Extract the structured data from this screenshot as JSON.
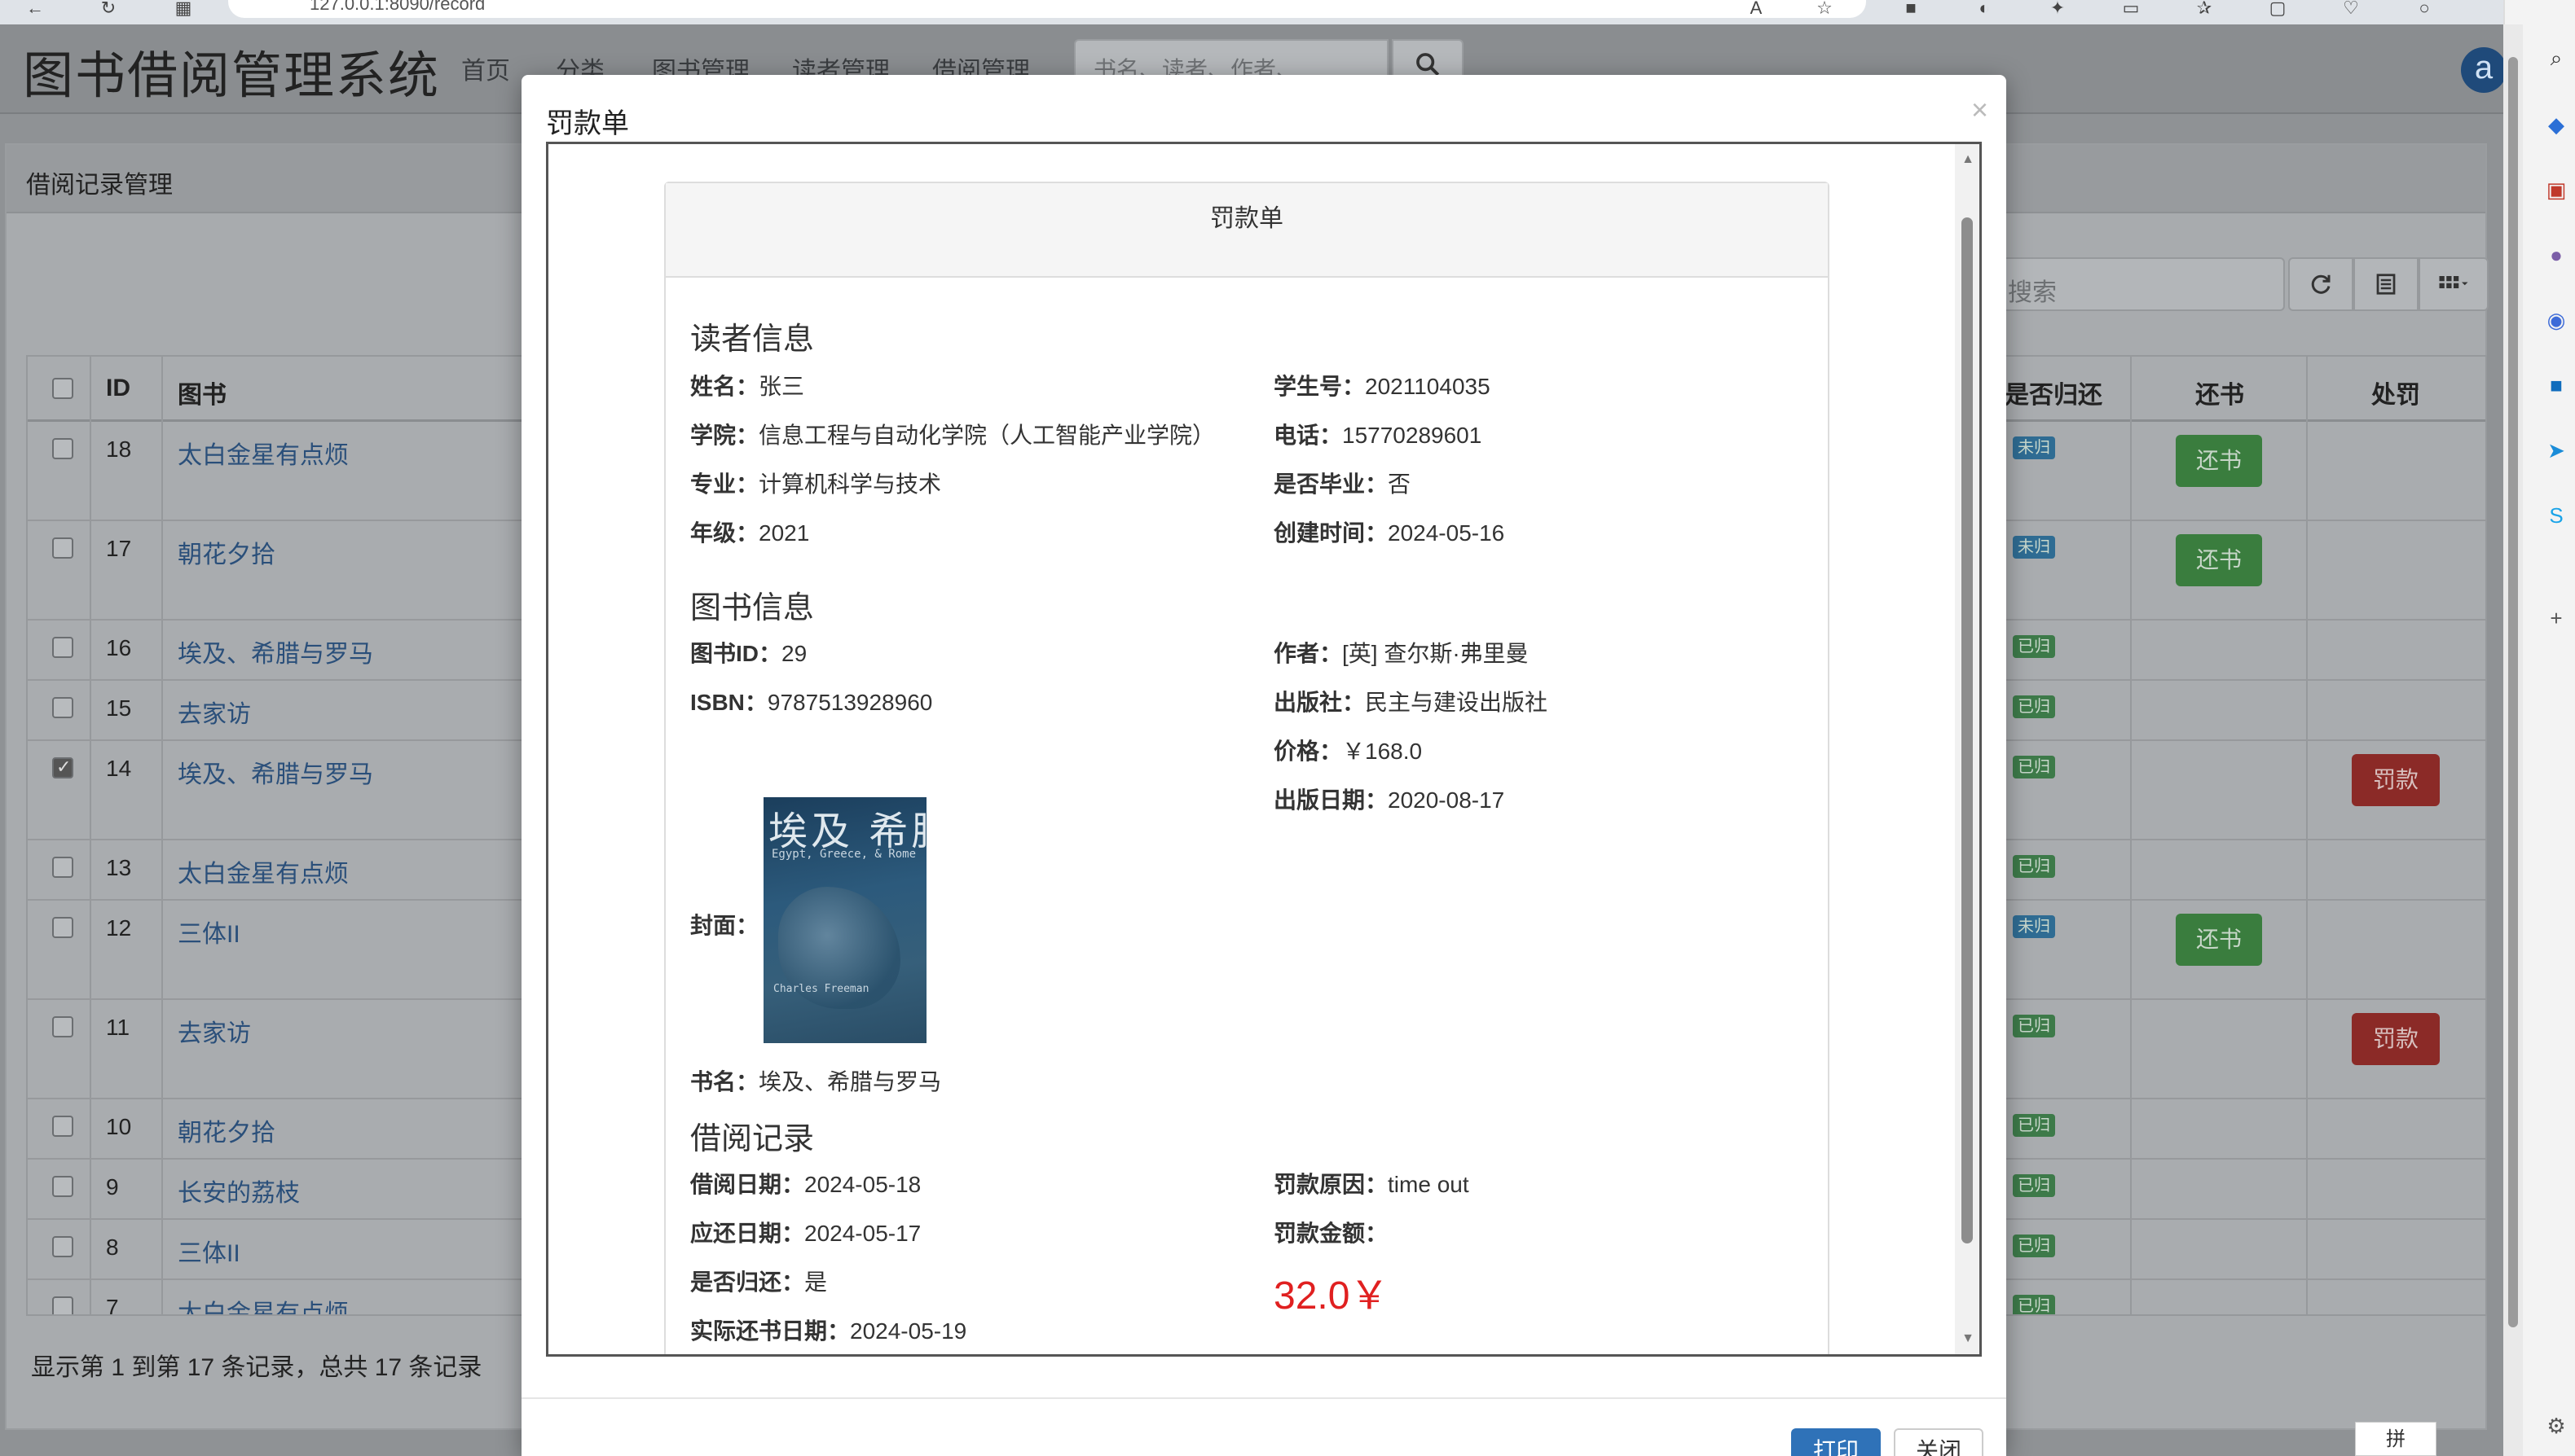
{
  "browser": {
    "url": "127.0.0.1:8090/record"
  },
  "navbar": {
    "brand": "图书借阅管理系统",
    "items": [
      "首页",
      "分类",
      "图书管理",
      "读者管理",
      "借阅管理"
    ],
    "search_placeholder": "书名、读者、作者、ISBN、",
    "avatar_letter": "a"
  },
  "page": {
    "panel_title": "借阅记录管理",
    "table_search_placeholder": "搜索",
    "columns": [
      "ID",
      "图书",
      "是否归还",
      "还书",
      "处罚"
    ],
    "rows": [
      {
        "id": "18",
        "book": "太白金星有点烦",
        "status": "未归还",
        "status_color": "blue",
        "return_btn": "还书",
        "fine_btn": ""
      },
      {
        "id": "17",
        "book": "朝花夕拾",
        "status": "未归还",
        "status_color": "blue",
        "return_btn": "还书",
        "fine_btn": ""
      },
      {
        "id": "16",
        "book": "埃及、希腊与罗马",
        "status": "已归还",
        "status_color": "green",
        "return_btn": "",
        "fine_btn": ""
      },
      {
        "id": "15",
        "book": "去家访",
        "status": "已归还",
        "status_color": "green",
        "return_btn": "",
        "fine_btn": ""
      },
      {
        "id": "14",
        "book": "埃及、希腊与罗马",
        "status": "已归还",
        "status_color": "green",
        "return_btn": "",
        "fine_btn": "罚款",
        "checked": true
      },
      {
        "id": "13",
        "book": "太白金星有点烦",
        "status": "已归还",
        "status_color": "green",
        "return_btn": "",
        "fine_btn": ""
      },
      {
        "id": "12",
        "book": "三体II",
        "status": "未归还",
        "status_color": "blue",
        "return_btn": "还书",
        "fine_btn": ""
      },
      {
        "id": "11",
        "book": "去家访",
        "status": "已归还",
        "status_color": "green",
        "return_btn": "",
        "fine_btn": "罚款"
      },
      {
        "id": "10",
        "book": "朝花夕拾",
        "status": "已归还",
        "status_color": "green",
        "return_btn": "",
        "fine_btn": ""
      },
      {
        "id": "9",
        "book": "长安的荔枝",
        "status": "已归还",
        "status_color": "green",
        "return_btn": "",
        "fine_btn": ""
      },
      {
        "id": "8",
        "book": "三体II",
        "status": "已归还",
        "status_color": "green",
        "return_btn": "",
        "fine_btn": ""
      },
      {
        "id": "7",
        "book": "太白金星有点烦",
        "status": "已归还",
        "status_color": "green",
        "return_btn": "",
        "fine_btn": ""
      }
    ],
    "pagination_info": "显示第 1 到第 17 条记录，总共 17 条记录"
  },
  "modal": {
    "title": "罚款单",
    "close_glyph": "×",
    "print_label": "打印",
    "close_label": "关闭",
    "sheet": {
      "heading": "罚款单",
      "reader_section": "读者信息",
      "reader": {
        "name_label": "姓名：",
        "name": "张三",
        "student_no_label": "学生号：",
        "student_no": "2021104035",
        "college_label": "学院：",
        "college": "信息工程与自动化学院（人工智能产业学院）",
        "phone_label": "电话：",
        "phone": "15770289601",
        "major_label": "专业：",
        "major": "计算机科学与技术",
        "graduated_label": "是否毕业：",
        "graduated": "否",
        "grade_label": "年级：",
        "grade": "2021",
        "created_label": "创建时间：",
        "created": "2024-05-16"
      },
      "book_section": "图书信息",
      "book": {
        "id_label": "图书ID：",
        "id": "29",
        "author_label": "作者：",
        "author": "[英] 查尔斯·弗里曼",
        "isbn_label": "ISBN：",
        "isbn": "9787513928960",
        "publisher_label": "出版社：",
        "publisher": "民主与建设出版社",
        "price_label": "价格：",
        "price": "￥168.0",
        "pubdate_label": "出版日期：",
        "pubdate": "2020-08-17",
        "cover_label": "封面：",
        "title_label": "书名：",
        "title": "埃及、希腊与罗马",
        "cover_title": "埃及 希腊",
        "cover_subtitle": "Egypt, Greece, & Rome",
        "cover_author": "Charles Freeman"
      },
      "record_section": "借阅记录",
      "record": {
        "borrow_date_label": "借阅日期：",
        "borrow_date": "2024-05-18",
        "fine_reason_label": "罚款原因：",
        "fine_reason": "time out",
        "due_date_label": "应还日期：",
        "due_date": "2024-05-17",
        "fine_amount_label": "罚款金额：",
        "returned_label": "是否归还：",
        "returned": "是",
        "amount": "32.0￥",
        "actual_return_label": "实际还书日期：",
        "actual_return": "2024-05-19"
      }
    }
  },
  "status_bar": {
    "ime": "拼"
  },
  "colors": {
    "accent_blue": "#2f72b8",
    "fine_red": "#e02020",
    "link_blue": "#2a4f7a"
  }
}
